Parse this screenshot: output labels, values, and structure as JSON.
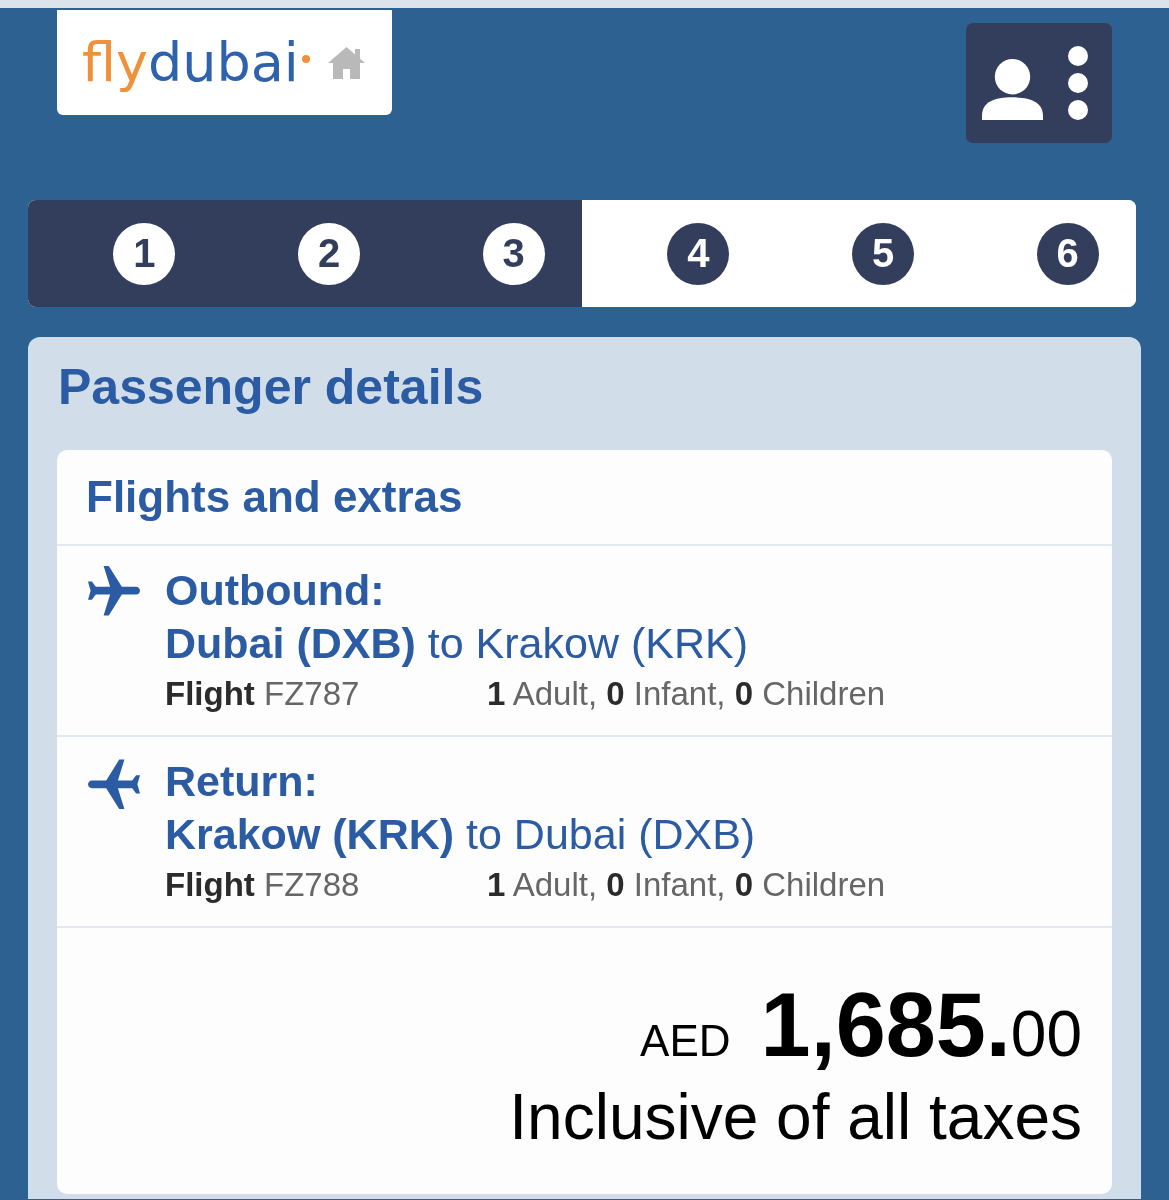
{
  "header": {
    "logo": {
      "first": "fly",
      "second": "dubai"
    }
  },
  "steps": [
    {
      "number": "1",
      "completed": true
    },
    {
      "number": "2",
      "completed": true
    },
    {
      "number": "3",
      "completed": true
    },
    {
      "number": "4",
      "completed": false
    },
    {
      "number": "5",
      "completed": false
    },
    {
      "number": "6",
      "completed": false
    }
  ],
  "panel": {
    "title": "Passenger details"
  },
  "card": {
    "title": "Flights and extras",
    "flights": [
      {
        "kind": "outbound",
        "label": "Outbound:",
        "route": "**Dubai (DXB)** to Krakow (KRK)",
        "flight": "**Flight** FZ787",
        "passengers": "**1** Adult, **0** Infant, **0** Children"
      },
      {
        "kind": "return",
        "label": "Return:",
        "route": "**Krakow (KRK)** to Dubai (DXB)",
        "flight": "**Flight** FZ788",
        "passengers": "**1** Adult, **0** Infant, **0** Children"
      }
    ]
  },
  "price": {
    "currency": "AED",
    "amount": "**1,685.**00",
    "note": "Inclusive of all taxes"
  }
}
